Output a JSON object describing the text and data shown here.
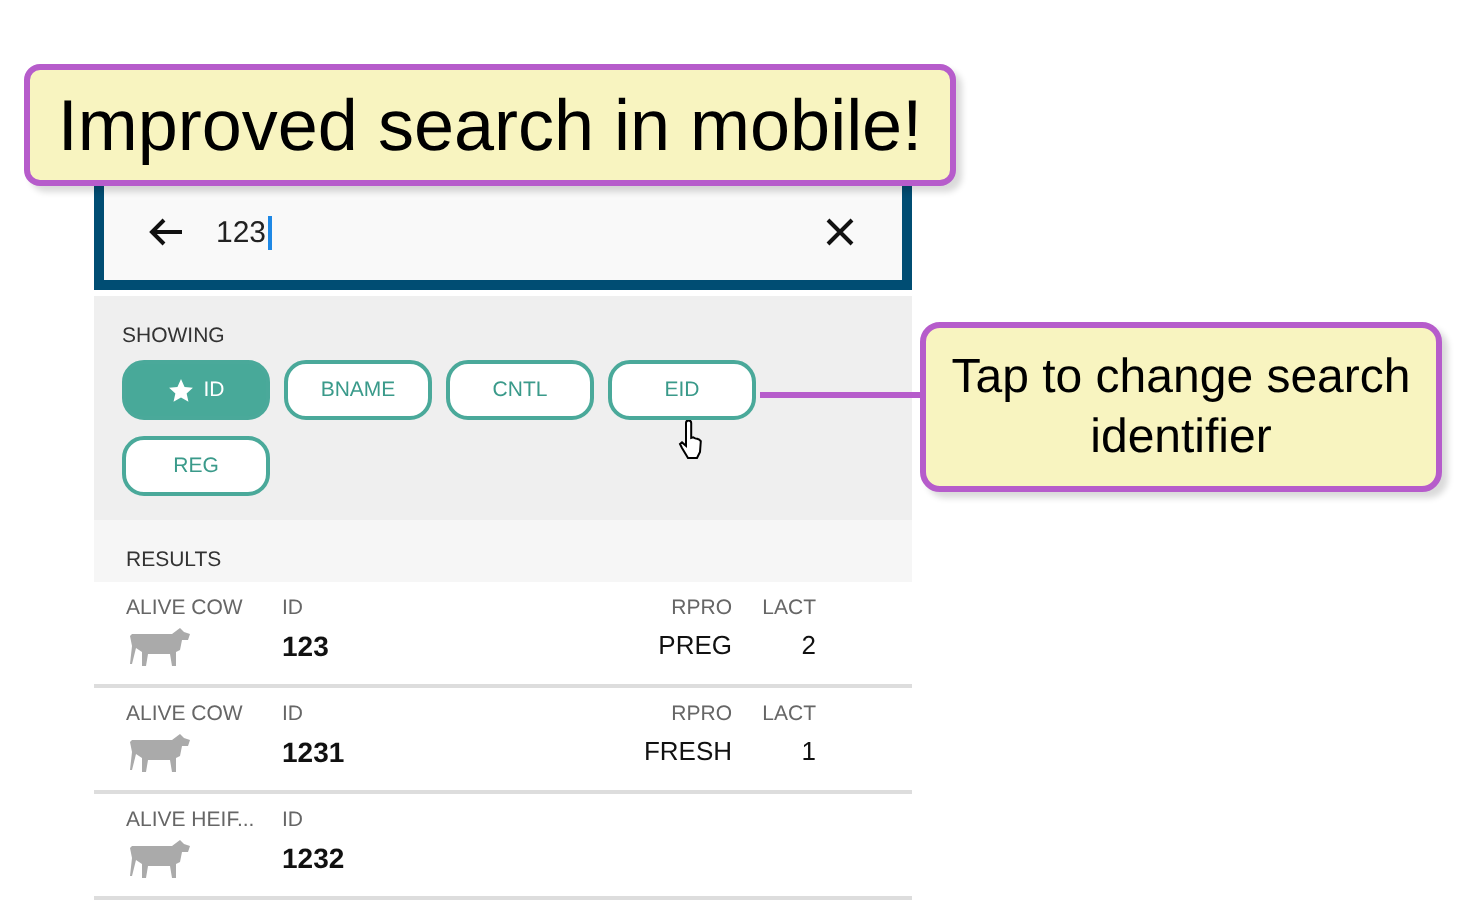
{
  "title_callout": {
    "text": "Improved search in mobile!"
  },
  "search": {
    "value": "123"
  },
  "showing": {
    "label": "SHOWING",
    "chips": [
      {
        "label": "ID",
        "selected": true
      },
      {
        "label": "BNAME",
        "selected": false
      },
      {
        "label": "CNTL",
        "selected": false
      },
      {
        "label": "EID",
        "selected": false
      },
      {
        "label": "REG",
        "selected": false
      }
    ]
  },
  "results": {
    "label": "RESULTS",
    "rows": [
      {
        "status": "ALIVE COW",
        "id_label": "ID",
        "id": "123",
        "fields": [
          {
            "label": "RPRO",
            "value": "PREG"
          },
          {
            "label": "LACT",
            "value": "2"
          }
        ]
      },
      {
        "status": "ALIVE COW",
        "id_label": "ID",
        "id": "1231",
        "fields": [
          {
            "label": "RPRO",
            "value": "FRESH"
          },
          {
            "label": "LACT",
            "value": "1"
          }
        ]
      },
      {
        "status": "ALIVE HEIF...",
        "id_label": "ID",
        "id": "1232",
        "fields": []
      }
    ]
  },
  "tip_callout": {
    "text": "Tap to change search identifier"
  }
}
